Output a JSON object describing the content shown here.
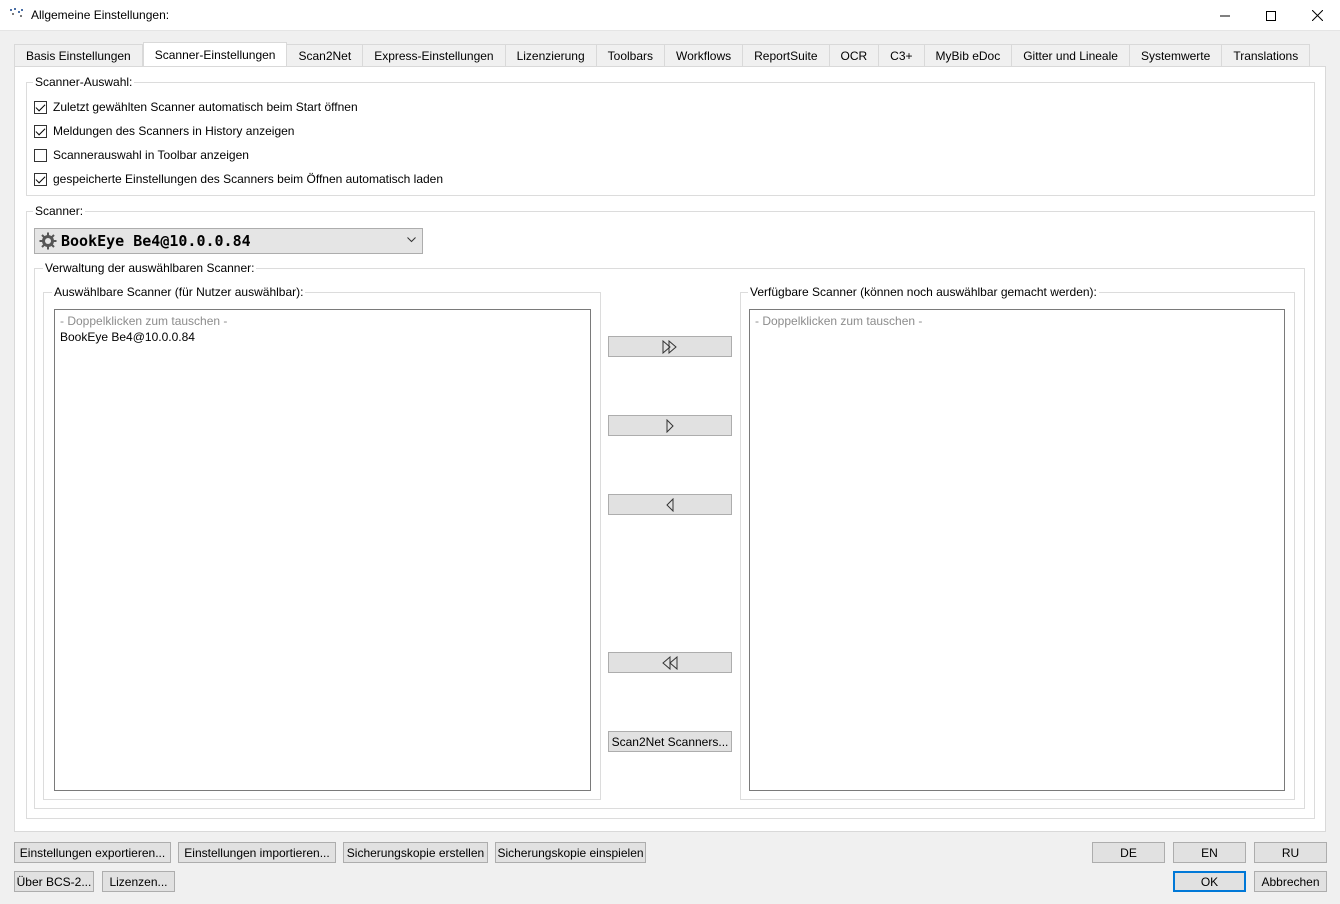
{
  "window": {
    "title": "Allgemeine Einstellungen:",
    "icon": "app-icon",
    "minimize_icon": "minimize-icon",
    "maximize_icon": "maximize-icon",
    "close_icon": "close-icon"
  },
  "tabs": [
    {
      "label": "Basis Einstellungen",
      "active": false
    },
    {
      "label": "Scanner-Einstellungen",
      "active": true
    },
    {
      "label": "Scan2Net",
      "active": false
    },
    {
      "label": "Express-Einstellungen",
      "active": false
    },
    {
      "label": "Lizenzierung",
      "active": false
    },
    {
      "label": "Toolbars",
      "active": false
    },
    {
      "label": "Workflows",
      "active": false
    },
    {
      "label": "ReportSuite",
      "active": false
    },
    {
      "label": "OCR",
      "active": false
    },
    {
      "label": "C3+",
      "active": false
    },
    {
      "label": "MyBib eDoc",
      "active": false
    },
    {
      "label": "Gitter und Lineale",
      "active": false
    },
    {
      "label": "Systemwerte",
      "active": false
    },
    {
      "label": "Translations",
      "active": false
    }
  ],
  "scanner_selection": {
    "legend": "Scanner-Auswahl:",
    "options": [
      {
        "label": "Zuletzt gewählten Scanner automatisch beim Start öffnen",
        "checked": true
      },
      {
        "label": "Meldungen des Scanners in History anzeigen",
        "checked": true
      },
      {
        "label": "Scannerauswahl in Toolbar anzeigen",
        "checked": false
      },
      {
        "label": "gespeicherte Einstellungen des Scanners beim Öffnen automatisch laden",
        "checked": true
      }
    ]
  },
  "scanner": {
    "legend": "Scanner:",
    "selected": "BookEye Be4@10.0.0.84",
    "combo_icon": "gear-icon",
    "management_legend": "Verwaltung der auswählbaren Scanner:",
    "selectable": {
      "legend": "Auswählbare Scanner (für Nutzer auswählbar):",
      "hint": "- Doppelklicken zum tauschen -",
      "items": [
        "BookEye Be4@10.0.0.84"
      ]
    },
    "available": {
      "legend": "Verfügbare Scanner (können noch auswählbar gemacht werden):",
      "hint": "- Doppelklicken zum tauschen -",
      "items": []
    },
    "scan2net_button": "Scan2Net Scanners..."
  },
  "footer": {
    "export": "Einstellungen exportieren...",
    "import": "Einstellungen importieren...",
    "backup_create": "Sicherungskopie erstellen",
    "backup_restore": "Sicherungskopie einspielen",
    "about": "Über BCS-2...",
    "licenses": "Lizenzen...",
    "lang_de": "DE",
    "lang_en": "EN",
    "lang_ru": "RU",
    "ok": "OK",
    "cancel": "Abbrechen"
  },
  "colors": {
    "accent": "#0078d7",
    "window_bg": "#f0f0f0",
    "panel_bg": "#ffffff",
    "hint_text": "#8c8c8c"
  }
}
